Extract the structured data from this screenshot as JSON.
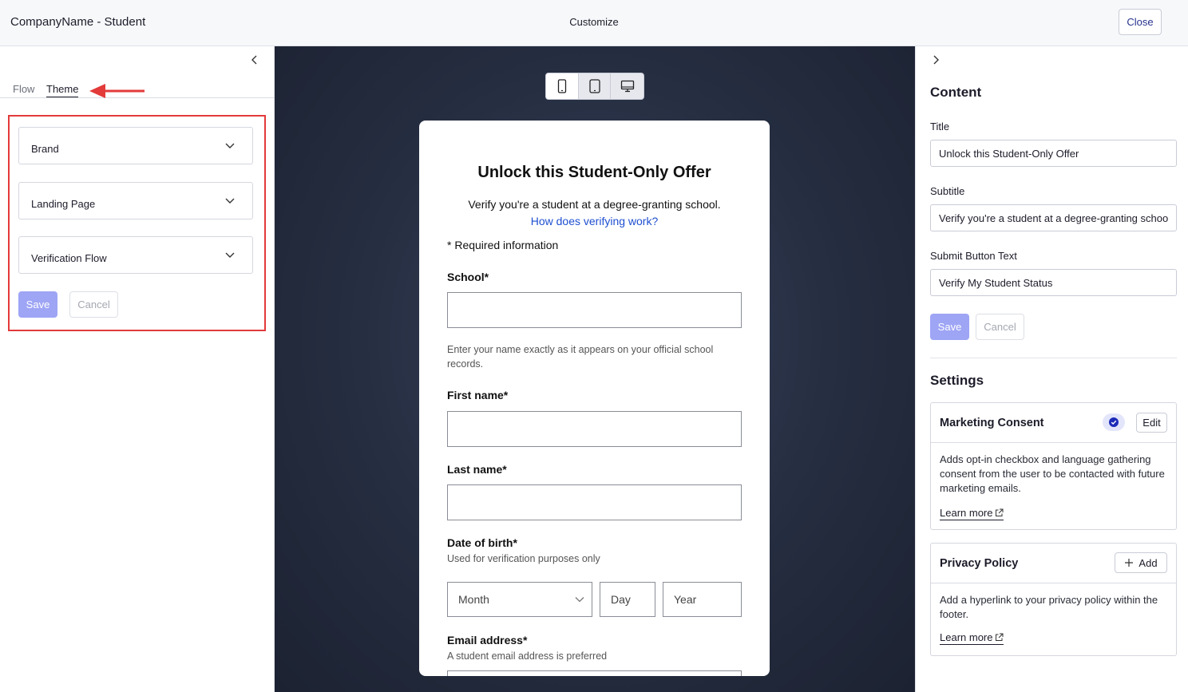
{
  "header": {
    "app_title": "CompanyName - Student",
    "center_title": "Customize",
    "close_label": "Close"
  },
  "left_panel": {
    "tabs": [
      {
        "label": "Flow",
        "active": false
      },
      {
        "label": "Theme",
        "active": true
      }
    ],
    "accordions": [
      {
        "label": "Brand"
      },
      {
        "label": "Landing Page"
      },
      {
        "label": "Verification Flow"
      }
    ],
    "save_label": "Save",
    "cancel_label": "Cancel"
  },
  "preview": {
    "device_modes": [
      "mobile-icon",
      "tablet-icon",
      "desktop-icon"
    ],
    "active_device": "mobile",
    "form": {
      "title": "Unlock this Student-Only Offer",
      "subtitle": "Verify you're a student at a degree-granting school.",
      "link": "How does verifying work?",
      "required_info": "* Required information",
      "school_label": "School*",
      "school_help": "Enter your name exactly as it appears on your official school records.",
      "first_name_label": "First name*",
      "last_name_label": "Last name*",
      "dob_label": "Date of birth*",
      "dob_help": "Used for verification purposes only",
      "dob_month": "Month",
      "dob_day": "Day",
      "dob_year": "Year",
      "email_label": "Email address*",
      "email_help": "A student email address is preferred"
    }
  },
  "right_panel": {
    "content_heading": "Content",
    "title_label": "Title",
    "title_value": "Unlock this Student-Only Offer",
    "subtitle_label": "Subtitle",
    "subtitle_value": "Verify you're a student at a degree-granting school.",
    "submit_label": "Submit Button Text",
    "submit_value": "Verify My Student Status",
    "save_label": "Save",
    "cancel_label": "Cancel",
    "settings_heading": "Settings",
    "marketing": {
      "title": "Marketing Consent",
      "edit_label": "Edit",
      "body": "Adds opt-in checkbox and language gathering consent from the user to be contacted with future marketing emails.",
      "learn_more": "Learn more"
    },
    "privacy": {
      "title": "Privacy Policy",
      "add_label": "Add",
      "body": "Add a hyperlink to your privacy policy within the footer.",
      "learn_more": "Learn more"
    }
  },
  "colors": {
    "accent": "#27338e",
    "save_button": "#9ea5f5",
    "annotation_red": "#e33a3a",
    "link_blue": "#1f4fd1",
    "preview_bg": "#252d40"
  }
}
